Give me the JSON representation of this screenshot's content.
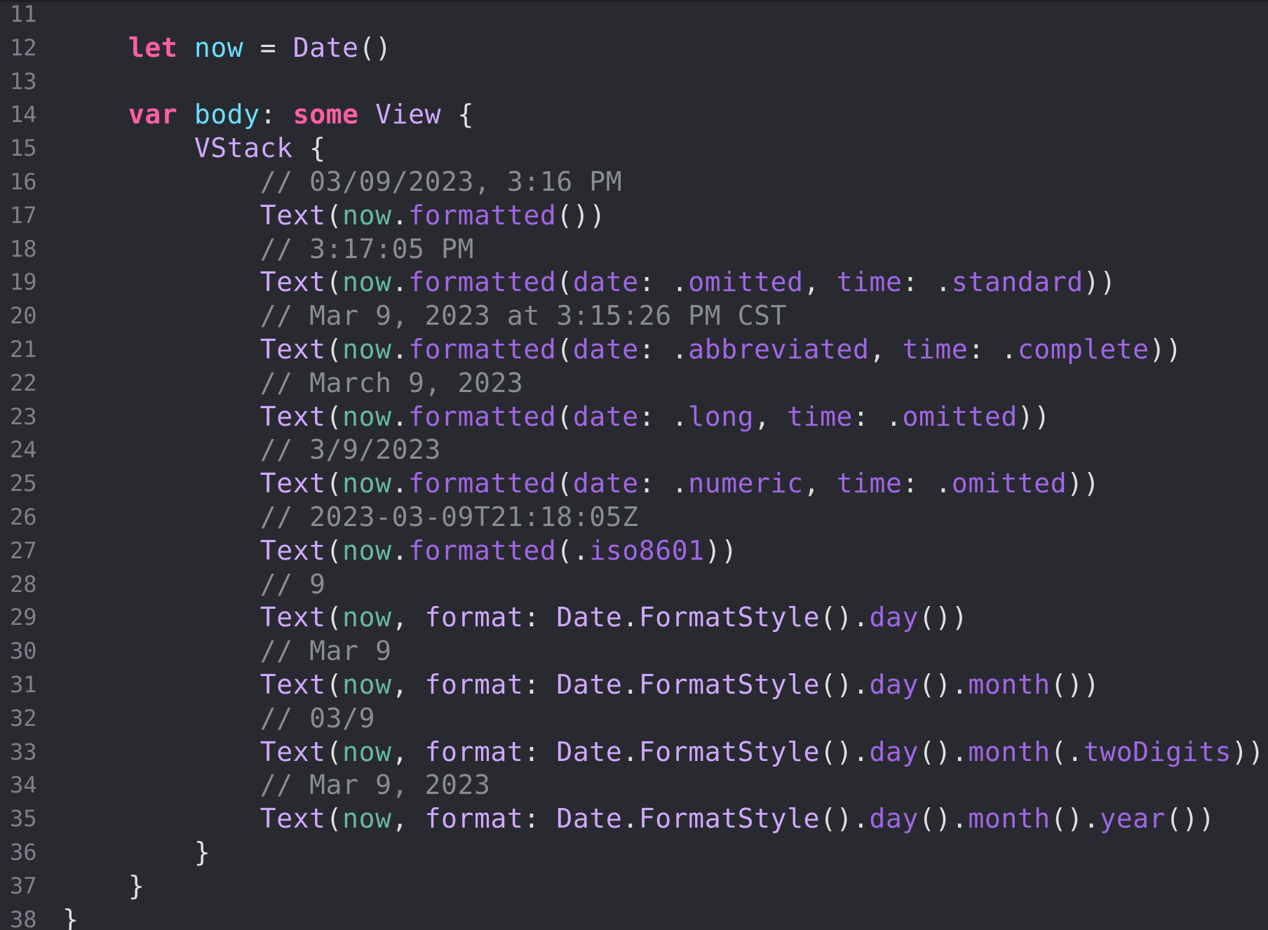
{
  "editor": {
    "theme": {
      "background": "#292a30",
      "line_number": "#7f8089",
      "keyword": "#fc5fa3",
      "comment": "#8a8c94",
      "type": "#d0a8ff",
      "variable": "#67b7a4",
      "function": "#a167e6",
      "declaration": "#6bdfff",
      "plain": "#dfdfe0"
    },
    "lines": [
      {
        "number": "11",
        "tokens": []
      },
      {
        "number": "12",
        "tokens": [
          {
            "t": "    ",
            "k": "plain"
          },
          {
            "t": "let",
            "k": "keyword"
          },
          {
            "t": " ",
            "k": "plain"
          },
          {
            "t": "now",
            "k": "decl"
          },
          {
            "t": " = ",
            "k": "plain"
          },
          {
            "t": "Date",
            "k": "type"
          },
          {
            "t": "()",
            "k": "plain"
          }
        ]
      },
      {
        "number": "13",
        "tokens": []
      },
      {
        "number": "14",
        "tokens": [
          {
            "t": "    ",
            "k": "plain"
          },
          {
            "t": "var",
            "k": "keyword"
          },
          {
            "t": " ",
            "k": "plain"
          },
          {
            "t": "body",
            "k": "decl"
          },
          {
            "t": ": ",
            "k": "plain"
          },
          {
            "t": "some",
            "k": "keyword"
          },
          {
            "t": " ",
            "k": "plain"
          },
          {
            "t": "View",
            "k": "type"
          },
          {
            "t": " {",
            "k": "plain"
          }
        ]
      },
      {
        "number": "15",
        "tokens": [
          {
            "t": "        ",
            "k": "plain"
          },
          {
            "t": "VStack",
            "k": "type"
          },
          {
            "t": " {",
            "k": "plain"
          }
        ]
      },
      {
        "number": "16",
        "tokens": [
          {
            "t": "            ",
            "k": "plain"
          },
          {
            "t": "// 03/09/2023, 3:16 PM",
            "k": "comment"
          }
        ]
      },
      {
        "number": "17",
        "tokens": [
          {
            "t": "            ",
            "k": "plain"
          },
          {
            "t": "Text",
            "k": "type"
          },
          {
            "t": "(",
            "k": "plain"
          },
          {
            "t": "now",
            "k": "var"
          },
          {
            "t": ".",
            "k": "plain"
          },
          {
            "t": "formatted",
            "k": "func"
          },
          {
            "t": "())",
            "k": "plain"
          }
        ]
      },
      {
        "number": "18",
        "tokens": [
          {
            "t": "            ",
            "k": "plain"
          },
          {
            "t": "// 3:17:05 PM",
            "k": "comment"
          }
        ]
      },
      {
        "number": "19",
        "tokens": [
          {
            "t": "            ",
            "k": "plain"
          },
          {
            "t": "Text",
            "k": "type"
          },
          {
            "t": "(",
            "k": "plain"
          },
          {
            "t": "now",
            "k": "var"
          },
          {
            "t": ".",
            "k": "plain"
          },
          {
            "t": "formatted",
            "k": "func"
          },
          {
            "t": "(",
            "k": "plain"
          },
          {
            "t": "date",
            "k": "param"
          },
          {
            "t": ": .",
            "k": "plain"
          },
          {
            "t": "omitted",
            "k": "member"
          },
          {
            "t": ", ",
            "k": "plain"
          },
          {
            "t": "time",
            "k": "param"
          },
          {
            "t": ": .",
            "k": "plain"
          },
          {
            "t": "standard",
            "k": "member"
          },
          {
            "t": "))",
            "k": "plain"
          }
        ]
      },
      {
        "number": "20",
        "tokens": [
          {
            "t": "            ",
            "k": "plain"
          },
          {
            "t": "// Mar 9, 2023 at 3:15:26 PM CST",
            "k": "comment"
          }
        ]
      },
      {
        "number": "21",
        "tokens": [
          {
            "t": "            ",
            "k": "plain"
          },
          {
            "t": "Text",
            "k": "type"
          },
          {
            "t": "(",
            "k": "plain"
          },
          {
            "t": "now",
            "k": "var"
          },
          {
            "t": ".",
            "k": "plain"
          },
          {
            "t": "formatted",
            "k": "func"
          },
          {
            "t": "(",
            "k": "plain"
          },
          {
            "t": "date",
            "k": "param"
          },
          {
            "t": ": .",
            "k": "plain"
          },
          {
            "t": "abbreviated",
            "k": "member"
          },
          {
            "t": ", ",
            "k": "plain"
          },
          {
            "t": "time",
            "k": "param"
          },
          {
            "t": ": .",
            "k": "plain"
          },
          {
            "t": "complete",
            "k": "member"
          },
          {
            "t": "))",
            "k": "plain"
          }
        ]
      },
      {
        "number": "22",
        "tokens": [
          {
            "t": "            ",
            "k": "plain"
          },
          {
            "t": "// March 9, 2023",
            "k": "comment"
          }
        ]
      },
      {
        "number": "23",
        "tokens": [
          {
            "t": "            ",
            "k": "plain"
          },
          {
            "t": "Text",
            "k": "type"
          },
          {
            "t": "(",
            "k": "plain"
          },
          {
            "t": "now",
            "k": "var"
          },
          {
            "t": ".",
            "k": "plain"
          },
          {
            "t": "formatted",
            "k": "func"
          },
          {
            "t": "(",
            "k": "plain"
          },
          {
            "t": "date",
            "k": "param"
          },
          {
            "t": ": .",
            "k": "plain"
          },
          {
            "t": "long",
            "k": "member"
          },
          {
            "t": ", ",
            "k": "plain"
          },
          {
            "t": "time",
            "k": "param"
          },
          {
            "t": ": .",
            "k": "plain"
          },
          {
            "t": "omitted",
            "k": "member"
          },
          {
            "t": "))",
            "k": "plain"
          }
        ]
      },
      {
        "number": "24",
        "tokens": [
          {
            "t": "            ",
            "k": "plain"
          },
          {
            "t": "// 3/9/2023",
            "k": "comment"
          }
        ]
      },
      {
        "number": "25",
        "tokens": [
          {
            "t": "            ",
            "k": "plain"
          },
          {
            "t": "Text",
            "k": "type"
          },
          {
            "t": "(",
            "k": "plain"
          },
          {
            "t": "now",
            "k": "var"
          },
          {
            "t": ".",
            "k": "plain"
          },
          {
            "t": "formatted",
            "k": "func"
          },
          {
            "t": "(",
            "k": "plain"
          },
          {
            "t": "date",
            "k": "param"
          },
          {
            "t": ": .",
            "k": "plain"
          },
          {
            "t": "numeric",
            "k": "member"
          },
          {
            "t": ", ",
            "k": "plain"
          },
          {
            "t": "time",
            "k": "param"
          },
          {
            "t": ": .",
            "k": "plain"
          },
          {
            "t": "omitted",
            "k": "member"
          },
          {
            "t": "))",
            "k": "plain"
          }
        ]
      },
      {
        "number": "26",
        "tokens": [
          {
            "t": "            ",
            "k": "plain"
          },
          {
            "t": "// 2023-03-09T21:18:05Z",
            "k": "comment"
          }
        ]
      },
      {
        "number": "27",
        "tokens": [
          {
            "t": "            ",
            "k": "plain"
          },
          {
            "t": "Text",
            "k": "type"
          },
          {
            "t": "(",
            "k": "plain"
          },
          {
            "t": "now",
            "k": "var"
          },
          {
            "t": ".",
            "k": "plain"
          },
          {
            "t": "formatted",
            "k": "func"
          },
          {
            "t": "(.",
            "k": "plain"
          },
          {
            "t": "iso8601",
            "k": "member"
          },
          {
            "t": "))",
            "k": "plain"
          }
        ]
      },
      {
        "number": "28",
        "tokens": [
          {
            "t": "            ",
            "k": "plain"
          },
          {
            "t": "// 9",
            "k": "comment"
          }
        ]
      },
      {
        "number": "29",
        "tokens": [
          {
            "t": "            ",
            "k": "plain"
          },
          {
            "t": "Text",
            "k": "type"
          },
          {
            "t": "(",
            "k": "plain"
          },
          {
            "t": "now",
            "k": "var"
          },
          {
            "t": ", ",
            "k": "plain"
          },
          {
            "t": "format",
            "k": "type"
          },
          {
            "t": ": ",
            "k": "plain"
          },
          {
            "t": "Date",
            "k": "type"
          },
          {
            "t": ".",
            "k": "plain"
          },
          {
            "t": "FormatStyle",
            "k": "type"
          },
          {
            "t": "().",
            "k": "plain"
          },
          {
            "t": "day",
            "k": "func"
          },
          {
            "t": "())",
            "k": "plain"
          }
        ]
      },
      {
        "number": "30",
        "tokens": [
          {
            "t": "            ",
            "k": "plain"
          },
          {
            "t": "// Mar 9",
            "k": "comment"
          }
        ]
      },
      {
        "number": "31",
        "tokens": [
          {
            "t": "            ",
            "k": "plain"
          },
          {
            "t": "Text",
            "k": "type"
          },
          {
            "t": "(",
            "k": "plain"
          },
          {
            "t": "now",
            "k": "var"
          },
          {
            "t": ", ",
            "k": "plain"
          },
          {
            "t": "format",
            "k": "type"
          },
          {
            "t": ": ",
            "k": "plain"
          },
          {
            "t": "Date",
            "k": "type"
          },
          {
            "t": ".",
            "k": "plain"
          },
          {
            "t": "FormatStyle",
            "k": "type"
          },
          {
            "t": "().",
            "k": "plain"
          },
          {
            "t": "day",
            "k": "func"
          },
          {
            "t": "().",
            "k": "plain"
          },
          {
            "t": "month",
            "k": "func"
          },
          {
            "t": "())",
            "k": "plain"
          }
        ]
      },
      {
        "number": "32",
        "tokens": [
          {
            "t": "            ",
            "k": "plain"
          },
          {
            "t": "// 03/9",
            "k": "comment"
          }
        ]
      },
      {
        "number": "33",
        "tokens": [
          {
            "t": "            ",
            "k": "plain"
          },
          {
            "t": "Text",
            "k": "type"
          },
          {
            "t": "(",
            "k": "plain"
          },
          {
            "t": "now",
            "k": "var"
          },
          {
            "t": ", ",
            "k": "plain"
          },
          {
            "t": "format",
            "k": "type"
          },
          {
            "t": ": ",
            "k": "plain"
          },
          {
            "t": "Date",
            "k": "type"
          },
          {
            "t": ".",
            "k": "plain"
          },
          {
            "t": "FormatStyle",
            "k": "type"
          },
          {
            "t": "().",
            "k": "plain"
          },
          {
            "t": "day",
            "k": "func"
          },
          {
            "t": "().",
            "k": "plain"
          },
          {
            "t": "month",
            "k": "func"
          },
          {
            "t": "(.",
            "k": "plain"
          },
          {
            "t": "twoDigits",
            "k": "member"
          },
          {
            "t": "))",
            "k": "plain"
          }
        ]
      },
      {
        "number": "34",
        "tokens": [
          {
            "t": "            ",
            "k": "plain"
          },
          {
            "t": "// Mar 9, 2023",
            "k": "comment"
          }
        ]
      },
      {
        "number": "35",
        "tokens": [
          {
            "t": "            ",
            "k": "plain"
          },
          {
            "t": "Text",
            "k": "type"
          },
          {
            "t": "(",
            "k": "plain"
          },
          {
            "t": "now",
            "k": "var"
          },
          {
            "t": ", ",
            "k": "plain"
          },
          {
            "t": "format",
            "k": "type"
          },
          {
            "t": ": ",
            "k": "plain"
          },
          {
            "t": "Date",
            "k": "type"
          },
          {
            "t": ".",
            "k": "plain"
          },
          {
            "t": "FormatStyle",
            "k": "type"
          },
          {
            "t": "().",
            "k": "plain"
          },
          {
            "t": "day",
            "k": "func"
          },
          {
            "t": "().",
            "k": "plain"
          },
          {
            "t": "month",
            "k": "func"
          },
          {
            "t": "().",
            "k": "plain"
          },
          {
            "t": "year",
            "k": "func"
          },
          {
            "t": "())",
            "k": "plain"
          }
        ]
      },
      {
        "number": "36",
        "tokens": [
          {
            "t": "        ",
            "k": "plain"
          },
          {
            "t": "}",
            "k": "plain"
          }
        ]
      },
      {
        "number": "37",
        "tokens": [
          {
            "t": "    ",
            "k": "plain"
          },
          {
            "t": "}",
            "k": "plain"
          }
        ]
      },
      {
        "number": "38",
        "tokens": [
          {
            "t": "}",
            "k": "plain"
          }
        ]
      }
    ]
  }
}
